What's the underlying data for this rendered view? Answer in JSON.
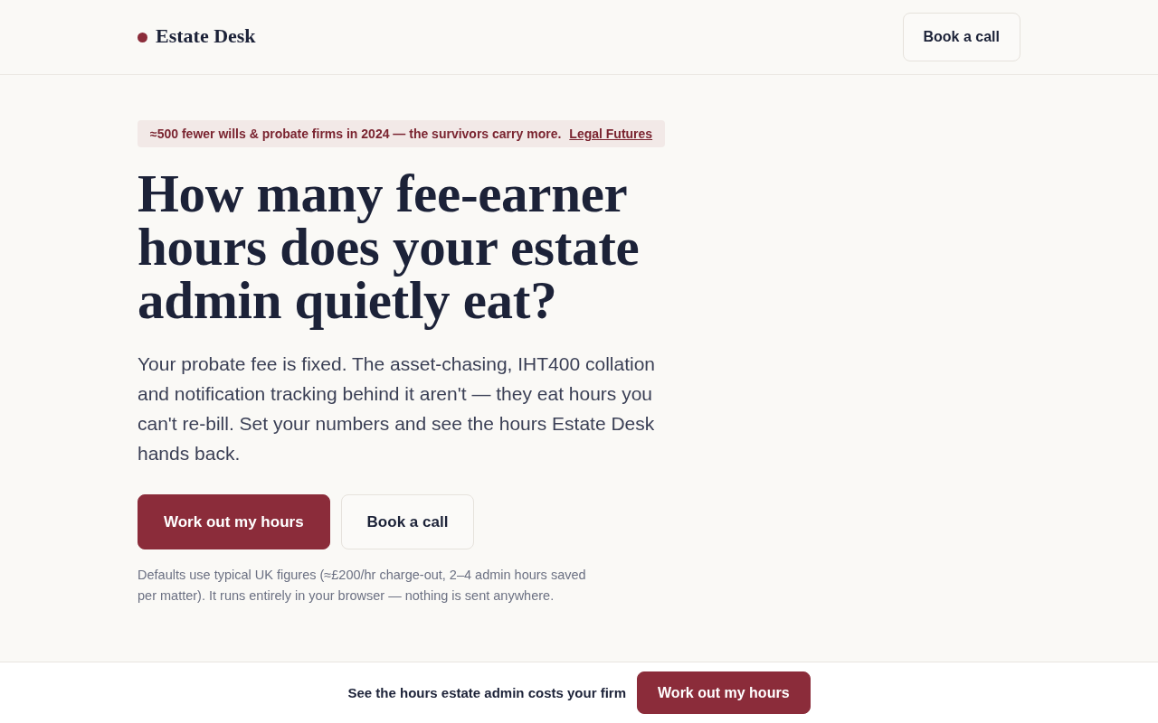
{
  "header": {
    "brand": "Estate Desk",
    "button": "Book a call"
  },
  "hero": {
    "banner": {
      "text": "≈500 fewer wills & probate firms in 2024 — the survivors carry more.",
      "link": "Legal Futures"
    },
    "headline": "How many fee-earner hours does your estate admin quietly eat?",
    "intro": "Your probate fee is fixed. The asset-chasing, IHT400 collation and notification tracking behind it aren't — they eat hours you can't re-bill. Set your numbers and see the hours Estate Desk hands back.",
    "buttons": [
      {
        "label": "Work out my hours",
        "kind": "primary"
      },
      {
        "label": "Book a call",
        "kind": "secondary"
      }
    ],
    "note": "Defaults use typical UK figures (≈£200/hr charge-out, 2–4 admin hours saved per matter). It runs entirely in your browser — nothing is sent anywhere."
  },
  "sticky_bar": {
    "text": "See the hours estate admin costs your firm",
    "button": "Work out my hours"
  }
}
